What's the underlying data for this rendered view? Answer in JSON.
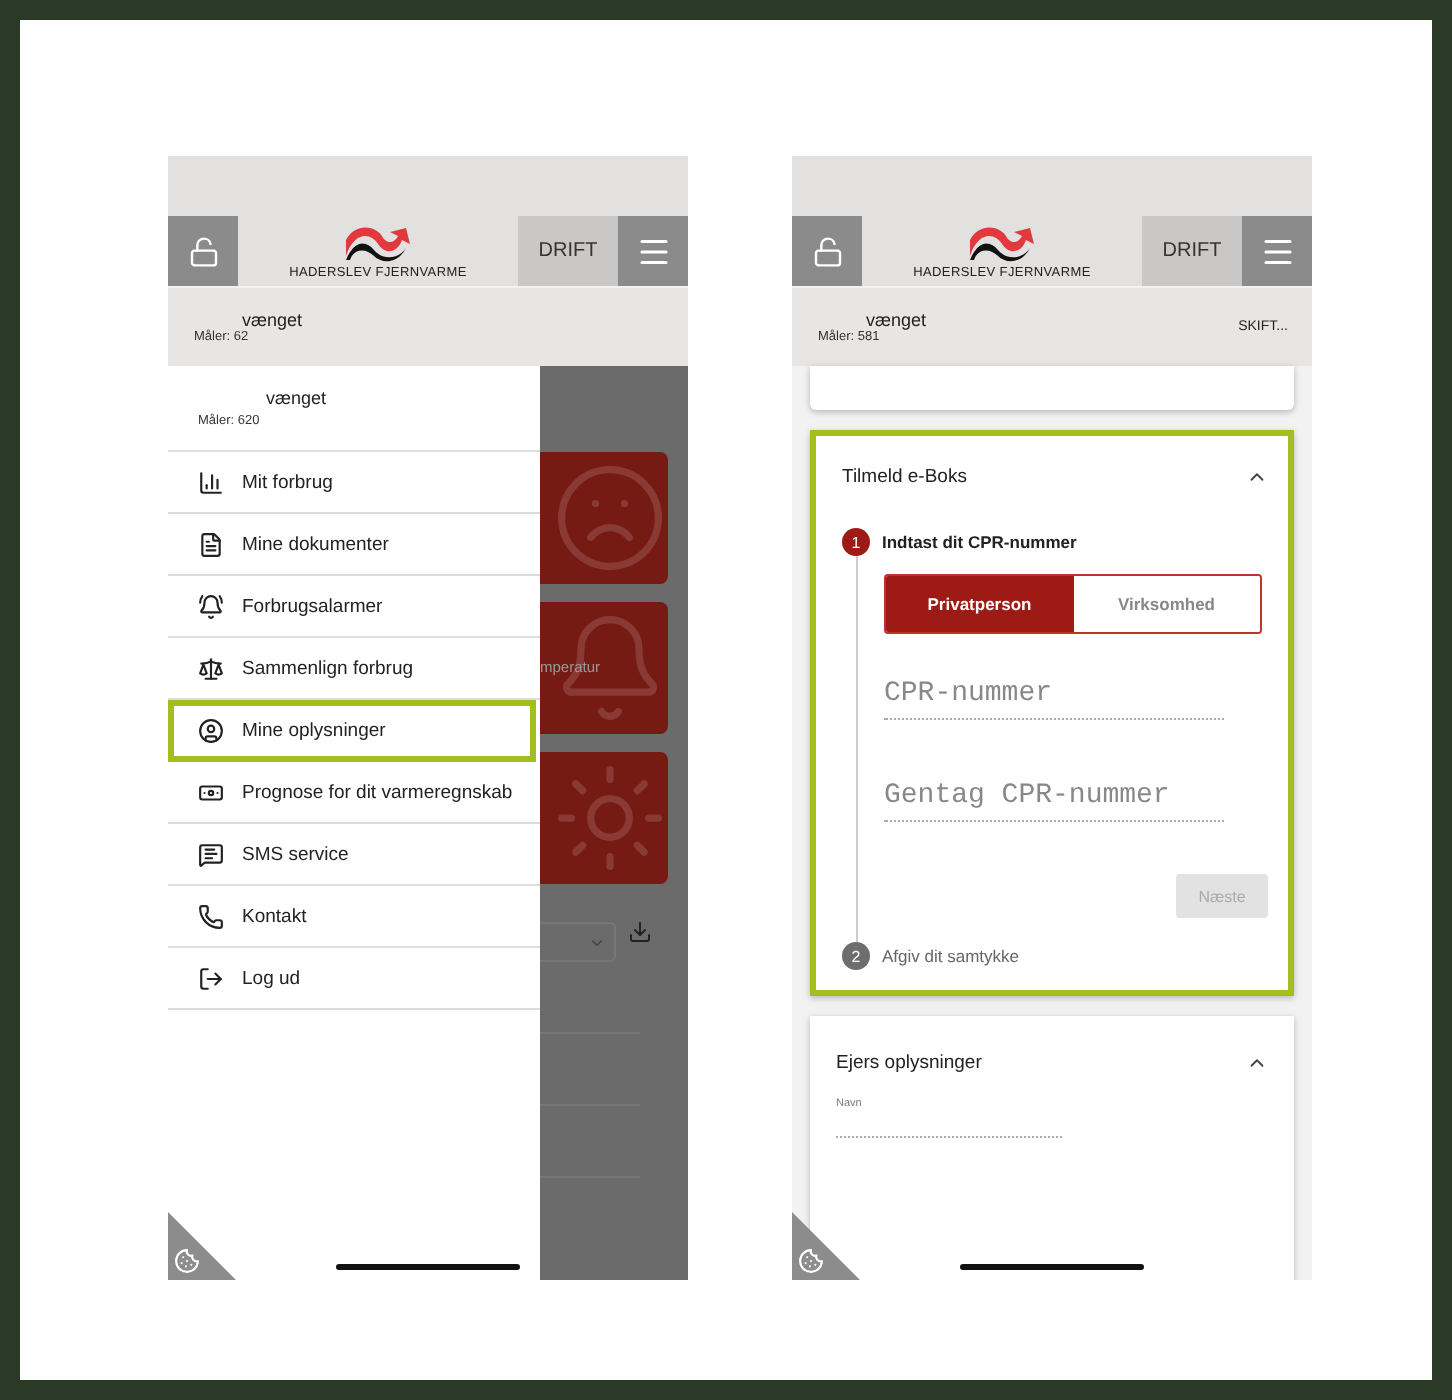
{
  "screens": [
    {
      "kind": "menu",
      "header": {
        "logo": "HADERSLEV FJERNVARME",
        "drift": "DRIFT"
      },
      "meter_bar": {
        "address": "vænget",
        "meter": "Måler: 62"
      },
      "background": {
        "card_text": "mperatur"
      },
      "drawer": {
        "address": "vænget",
        "meter": "Måler: 620",
        "items": [
          {
            "label": "Mit forbrug",
            "selected": false
          },
          {
            "label": "Mine dokumenter",
            "selected": false
          },
          {
            "label": "Forbrugsalarmer",
            "selected": false
          },
          {
            "label": "Sammenlign forbrug",
            "selected": false
          },
          {
            "label": "Mine oplysninger",
            "selected": true
          },
          {
            "label": "Prognose for dit varmeregnskab",
            "selected": false
          },
          {
            "label": "SMS service",
            "selected": false
          },
          {
            "label": "Kontakt",
            "selected": false
          },
          {
            "label": "Log ud",
            "selected": false
          }
        ]
      }
    },
    {
      "kind": "form",
      "header": {
        "logo": "HADERSLEV FJERNVARME",
        "drift": "DRIFT"
      },
      "meter_bar": {
        "address": "vænget",
        "meter": "Måler: 581",
        "action": "SKIFT..."
      },
      "eboks": {
        "title": "Tilmeld e-Boks",
        "expanded": true,
        "highlighted": true,
        "steps": [
          {
            "number": "1",
            "label": "Indtast dit CPR-nummer",
            "active": true
          },
          {
            "number": "2",
            "label": "Afgiv dit samtykke",
            "active": false
          }
        ],
        "options": [
          {
            "label": "Privatperson",
            "selected": true
          },
          {
            "label": "Virksomhed",
            "selected": false
          }
        ],
        "fields": [
          {
            "placeholder": "CPR-nummer"
          },
          {
            "placeholder": "Gentag CPR-nummer"
          }
        ],
        "next_button": {
          "label": "Næste",
          "disabled": true
        }
      },
      "owner": {
        "title": "Ejers oplysninger",
        "expanded": true,
        "field_label": "Navn"
      }
    }
  ]
}
